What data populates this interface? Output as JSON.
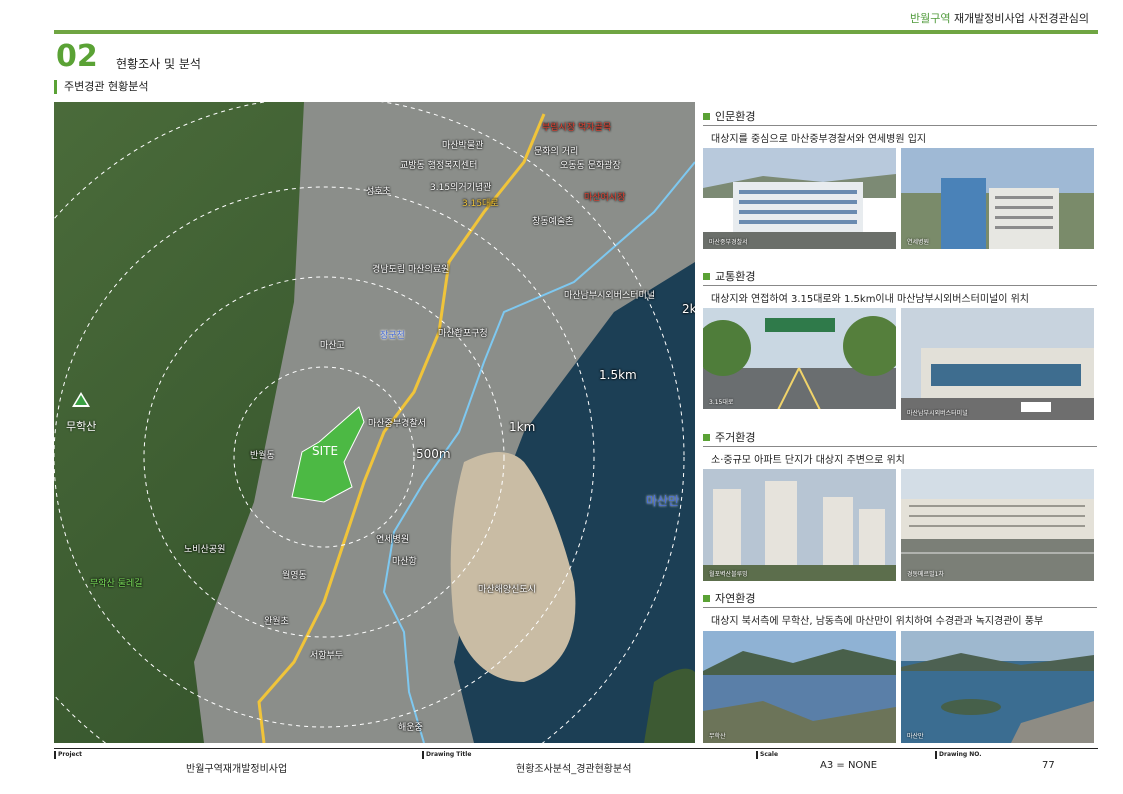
{
  "header": {
    "accent": "반월구역",
    "title": "재개발정비사업 사전경관심의"
  },
  "section": {
    "number": "02",
    "title": "현황조사 및 분석",
    "subtitle": "주변경관 현황분석"
  },
  "map": {
    "site_label": "SITE",
    "mountain": "무학산",
    "bay": "마산만",
    "radii": [
      "500m",
      "1km",
      "1.5km",
      "2k"
    ],
    "road_labels": [
      "3.15대로",
      "장군천"
    ],
    "labels": [
      "부림시장 먹자골목",
      "문화의 거리",
      "마산박물관",
      "오동동 문화광장",
      "교방동 행정복지센터",
      "3.15의거기념관",
      "창동예술촌",
      "마산어시장",
      "마산중부경찰서",
      "경남도립 마산의료원",
      "성호초",
      "마산고",
      "마산합포구청",
      "마산항",
      "마산해양신도시",
      "마산남부시외버스터미널",
      "연세병원",
      "반월동",
      "완월초",
      "월영동",
      "해운중",
      "무학산 둘레길",
      "노비산공원",
      "서항부두"
    ],
    "colors": {
      "site": "#4cb944",
      "road_main": "#f0c43a",
      "road_coast": "#7ec8f0"
    }
  },
  "panels": [
    {
      "heading": "인문환경",
      "desc": "대상지를 중심으로 마산중부경찰서와 연세병원 입지",
      "photos": [
        "마산중부경찰서",
        "연세병원"
      ]
    },
    {
      "heading": "교통환경",
      "desc": "대상지와 연접하여 3.15대로와 1.5km이내 마산남부시외버스터미널이 위치",
      "photos": [
        "3.15대로",
        "마산남부시외버스터미널"
      ]
    },
    {
      "heading": "주거환경",
      "desc": "소·중규모 아파트 단지가 대상지 주변으로 위치",
      "photos": [
        "월포벽산블루밍",
        "경동메르빌1차"
      ]
    },
    {
      "heading": "자연환경",
      "desc": "대상지 북서측에 무학산, 남동측에 마산만이 위치하여 수경관과 녹지경관이 풍부",
      "photos": [
        "무학산",
        "마산만"
      ]
    }
  ],
  "footer": {
    "project_label": "Project",
    "project": "반월구역재개발정비사업",
    "drawing_title_label": "Drawing Title",
    "drawing_title": "현황조사분석_경관현황분석",
    "scale_label": "Scale",
    "scale": "A3 = NONE",
    "drawing_no_label": "Drawing NO.",
    "drawing_no": "77"
  }
}
